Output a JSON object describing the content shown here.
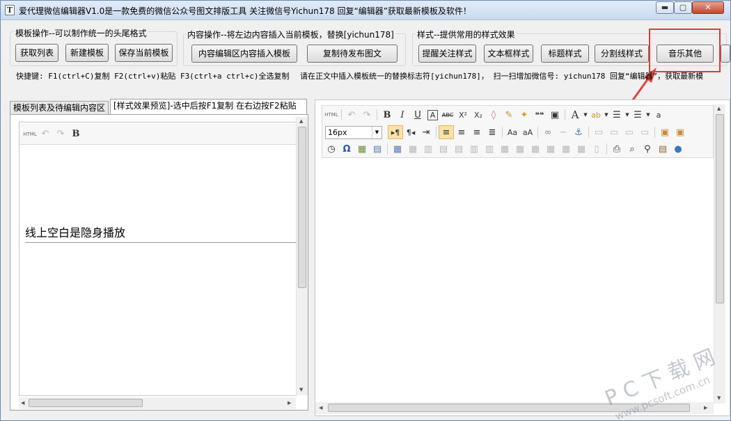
{
  "window": {
    "app_icon": "T",
    "title": "爱代理微信编辑器V1.0是一款免费的微信公众号图文排版工具 关注微信号Yichun178 回复“编辑器”获取最新模板及软件！",
    "controls": {
      "minimize": "▬",
      "maximize": "▢",
      "close": "✕"
    }
  },
  "groups": {
    "template": {
      "label": "模板操作--可以制作统一的头尾格式",
      "buttons": [
        "获取列表",
        "新建模板",
        "保存当前模板"
      ]
    },
    "content": {
      "label": "内容操作--将左边内容插入当前模板，替换[yichun178]",
      "buttons": [
        "内容编辑区内容插入模板",
        "复制待发布图文"
      ]
    },
    "style": {
      "label": "样式--提供常用的样式效果",
      "buttons": [
        "提醒关注样式",
        "文本框样式",
        "标题样式",
        "分割线样式",
        "音乐其他"
      ]
    }
  },
  "shortcuts": {
    "keys": "快捷键: F1(ctrl+C)复制  F2(ctrl+v)粘贴 F3(ctrl+a ctrl+c)全选复制",
    "hint": "请在正文中插入模板统一的替换标志符[yichun178]，  扫一扫增加微信号: yichun178 回复“编辑器”，获取最新模"
  },
  "tabs": [
    {
      "label": "模板列表及待编辑内容区"
    },
    {
      "label": "[样式效果预览]-选中后按F1复制 在右边按F2粘贴"
    }
  ],
  "left_editor": {
    "toolbar": {
      "html": "HTML",
      "bold": "B"
    },
    "preview_text": "线上空白是隐身播放"
  },
  "right_editor": {
    "toolbar_row1": {
      "html": "HTML",
      "bold": "B",
      "italic": "I",
      "underline": "U",
      "font_border": "A",
      "strikethrough": "ABC",
      "superscript": "X²",
      "subscript": "X₂",
      "quote": "❝❝"
    },
    "font_size": "16px"
  },
  "watermark": {
    "line1": "P C 下 载 网",
    "line2": "www.pcsoft.com.cn"
  },
  "colors": {
    "highlight": "#e23b3b",
    "accent": "#d9463c"
  }
}
